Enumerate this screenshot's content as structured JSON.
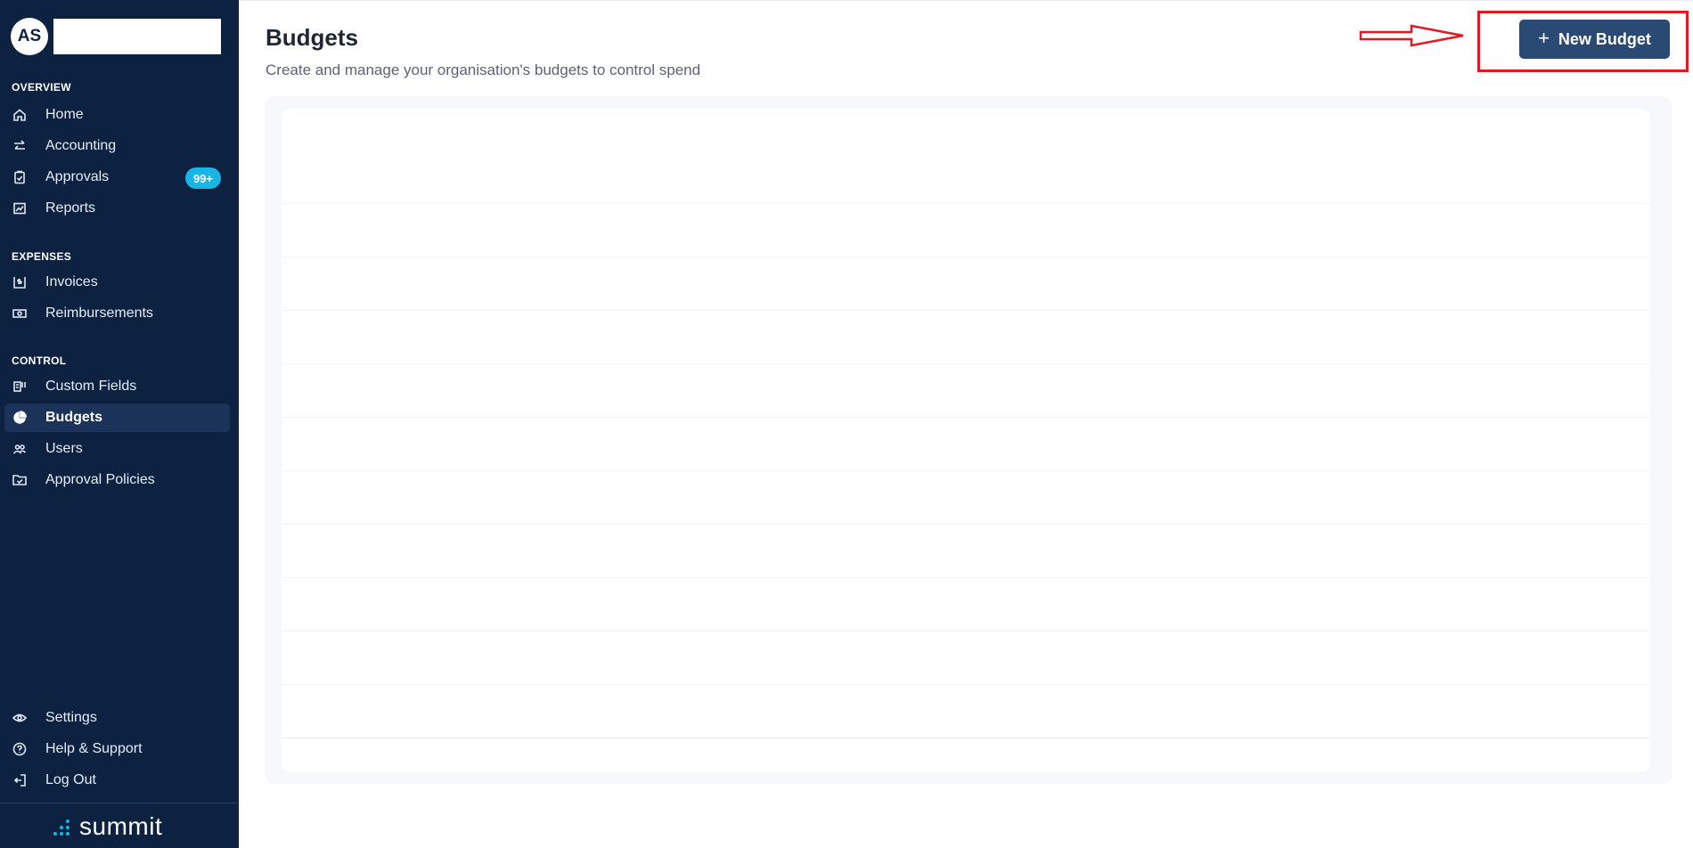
{
  "sidebar": {
    "avatar_initials": "AS",
    "sections": {
      "overview": "OVERVIEW",
      "expenses": "EXPENSES",
      "control": "CONTROL"
    },
    "items": {
      "home": "Home",
      "accounting": "Accounting",
      "approvals": "Approvals",
      "approvals_badge": "99+",
      "reports": "Reports",
      "invoices": "Invoices",
      "reimbursements": "Reimbursements",
      "custom_fields": "Custom Fields",
      "budgets": "Budgets",
      "users": "Users",
      "approval_policies": "Approval Policies",
      "settings": "Settings",
      "help_support": "Help & Support",
      "log_out": "Log Out"
    },
    "brand": "summit",
    "active_item": "Budgets"
  },
  "main": {
    "title": "Budgets",
    "subtitle": "Create and manage your organisation's budgets to control spend",
    "new_budget_button": "New Budget"
  },
  "colors": {
    "sidebar_bg": "#0d2241",
    "active_item_bg": "#1b3358",
    "badge_bg": "#19b3e6",
    "primary_button": "#2a4a73",
    "annotation_red": "#e01a22"
  }
}
